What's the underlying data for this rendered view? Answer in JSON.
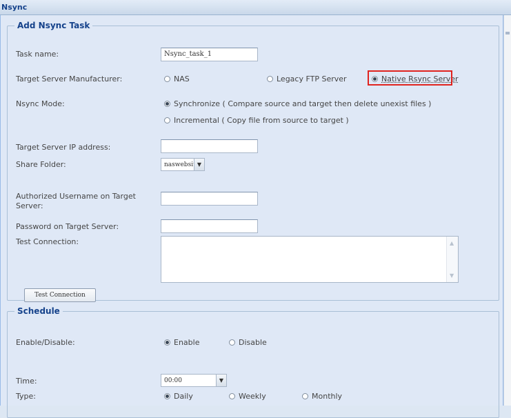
{
  "window": {
    "title": "Nsync"
  },
  "task": {
    "legend": "Add Nsync Task",
    "task_name": {
      "label": "Task name:",
      "value": "Nsync_task_1"
    },
    "manufacturer": {
      "label": "Target Server Manufacturer:",
      "options": [
        "NAS",
        "Legacy FTP Server",
        "Native Rsync Server"
      ],
      "selected": "Native Rsync Server"
    },
    "mode": {
      "label": "Nsync Mode:",
      "options": [
        "Synchronize ( Compare source and target then delete unexist files )",
        "Incremental ( Copy file from source to target )"
      ],
      "selected": "Synchronize"
    },
    "ip": {
      "label": "Target Server IP address:",
      "value": ""
    },
    "share": {
      "label": "Share Folder:",
      "value": "naswebsite"
    },
    "username": {
      "label": "Authorized Username on Target Server:",
      "value": ""
    },
    "password": {
      "label": "Password on Target Server:",
      "value": ""
    },
    "test": {
      "label": "Test Connection:",
      "value": "",
      "button": "Test Connection"
    }
  },
  "schedule": {
    "legend": "Schedule",
    "enable": {
      "label": "Enable/Disable:",
      "options": [
        "Enable",
        "Disable"
      ],
      "selected": "Enable"
    },
    "time": {
      "label": "Time:",
      "value": "00:00"
    },
    "type": {
      "label": "Type:",
      "options": [
        "Daily",
        "Weekly",
        "Monthly"
      ],
      "selected": "Daily"
    }
  },
  "colors": {
    "highlight": "#e0231e",
    "title": "#15428b"
  }
}
